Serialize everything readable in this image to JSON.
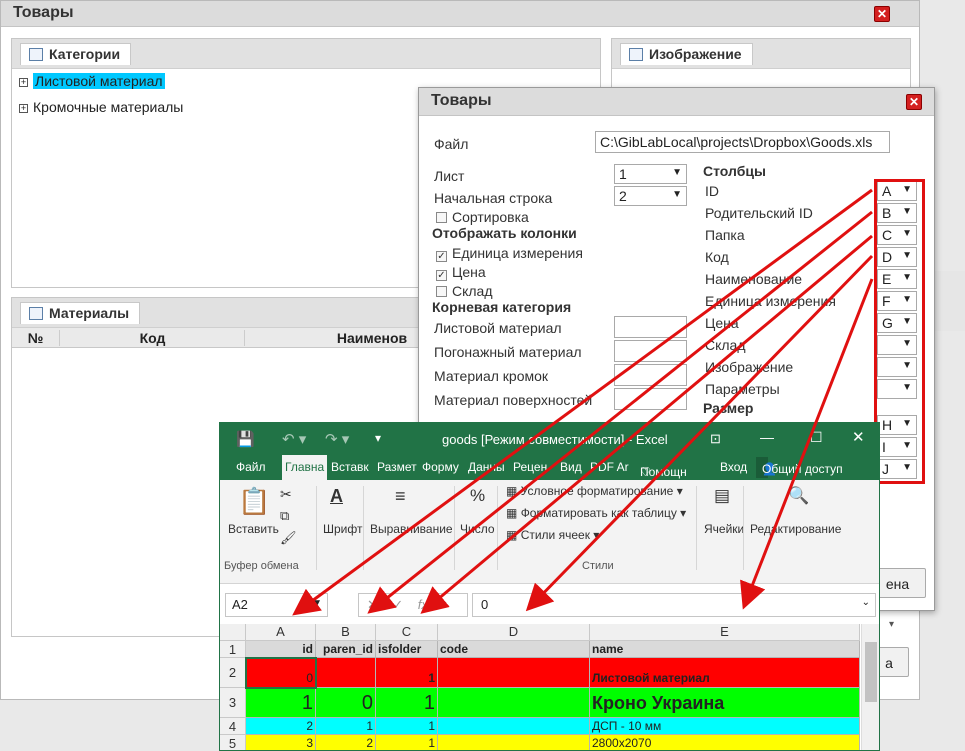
{
  "main": {
    "title": "Товары",
    "categories_tab": "Категории",
    "tree": [
      "Листовой материал",
      "Кромочные материалы"
    ],
    "image_tab": "Изображение",
    "materials_tab": "Материалы",
    "grid_cols": [
      "№",
      "Код",
      "Наименов"
    ],
    "btn1_tail": "ена",
    "btn2_tail": "а"
  },
  "dialog": {
    "title": "Товары",
    "file_label": "Файл",
    "file_value": "C:\\GibLabLocal\\projects\\Dropbox\\Goods.xls",
    "sheet_label": "Лист",
    "sheet_value": "1",
    "start_row_label": "Начальная строка",
    "start_row_value": "2",
    "sort_label": "Сортировка",
    "show_cols_header": "Отображать колонки",
    "show_cols": [
      {
        "label": "Единица измерения",
        "checked": true
      },
      {
        "label": "Цена",
        "checked": true
      },
      {
        "label": "Склад",
        "checked": false
      }
    ],
    "root_cat_header": "Корневая категория",
    "root_cats": [
      "Листовой материал",
      "Погонажный материал",
      "Материал кромок",
      "Материал поверхностей"
    ],
    "columns_header": "Столбцы",
    "columns": [
      {
        "label": "ID",
        "value": "A"
      },
      {
        "label": "Родительский ID",
        "value": "B"
      },
      {
        "label": "Папка",
        "value": "C"
      },
      {
        "label": "Код",
        "value": "D"
      },
      {
        "label": "Наименование",
        "value": "E"
      },
      {
        "label": "Единица измерения",
        "value": "F"
      },
      {
        "label": "Цена",
        "value": "G"
      },
      {
        "label": "Склад",
        "value": ""
      },
      {
        "label": "Изображение",
        "value": ""
      },
      {
        "label": "Параметры",
        "value": ""
      }
    ],
    "size_header": "Размер",
    "size_values": [
      "H",
      "I",
      "J"
    ]
  },
  "excel": {
    "title": "goods  [Режим совместимости] - Excel",
    "menu": [
      "Файл",
      "Главна",
      "Вставк",
      "Размет",
      "Форму",
      "Данны",
      "Рецен",
      "Вид",
      "PDF Ar",
      "Помощн",
      "Вход",
      "Общий доступ"
    ],
    "ribbon": {
      "paste": "Вставить",
      "clipboard": "Буфер обмена",
      "font": "Шрифт",
      "align": "Выравнивание",
      "number": "Число",
      "cond_fmt": "Условное форматирование",
      "fmt_table": "Форматировать как таблицу",
      "cell_styles": "Стили ячеек",
      "styles": "Стили",
      "cells": "Ячейки",
      "editing": "Редактирование"
    },
    "name_box": "A2",
    "formula_value": "0",
    "fx": "fx",
    "col_headers": [
      "A",
      "B",
      "C",
      "D",
      "E"
    ],
    "rows": [
      {
        "n": "1",
        "cells": [
          "id",
          "paren_id",
          "isfolder",
          "code",
          "name"
        ],
        "color": "#ffffff"
      },
      {
        "n": "2",
        "cells": [
          "0",
          "",
          "1",
          "",
          "Листовой материал"
        ],
        "color": "#ff0000"
      },
      {
        "n": "3",
        "cells": [
          "1",
          "0",
          "1",
          "",
          "Кроно Украина"
        ],
        "color": "#00ff00"
      },
      {
        "n": "4",
        "cells": [
          "2",
          "1",
          "1",
          "",
          "ДСП - 10 мм"
        ],
        "color": "#00ffff"
      },
      {
        "n": "5",
        "cells": [
          "3",
          "2",
          "1",
          "",
          "2800x2070"
        ],
        "color": "#ffff00"
      }
    ]
  },
  "colors": {
    "accent_red": "#e01010",
    "excel_green": "#217346",
    "highlight": "#00c8ff"
  }
}
